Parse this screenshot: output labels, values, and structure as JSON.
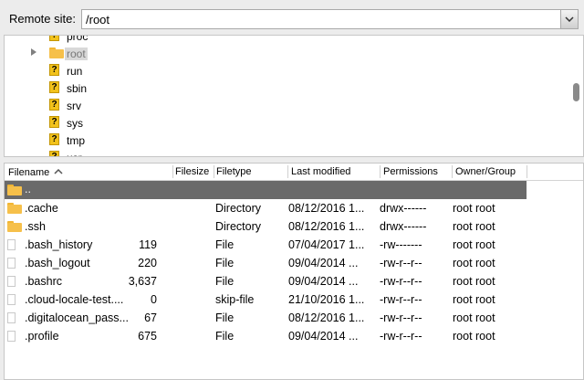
{
  "remote_site": {
    "label": "Remote site:",
    "path": "/root"
  },
  "tree": {
    "items": [
      {
        "label": "proc",
        "icon": "unknown-folder-icon",
        "selected": false
      },
      {
        "label": "root",
        "icon": "folder-icon",
        "selected": true
      },
      {
        "label": "run",
        "icon": "unknown-folder-icon",
        "selected": false
      },
      {
        "label": "sbin",
        "icon": "unknown-folder-icon",
        "selected": false
      },
      {
        "label": "srv",
        "icon": "unknown-folder-icon",
        "selected": false
      },
      {
        "label": "sys",
        "icon": "unknown-folder-icon",
        "selected": false
      },
      {
        "label": "tmp",
        "icon": "unknown-folder-icon",
        "selected": false
      },
      {
        "label": "usr",
        "icon": "unknown-folder-icon",
        "selected": false
      }
    ]
  },
  "list": {
    "columns": {
      "filename": "Filename",
      "filesize": "Filesize",
      "filetype": "Filetype",
      "last_modified": "Last modified",
      "permissions": "Permissions",
      "owner_group": "Owner/Group"
    },
    "parent_label": "..",
    "rows": [
      {
        "name": ".cache",
        "size": "",
        "type": "Directory",
        "modified": "08/12/2016 1...",
        "perms": "drwx------",
        "owner": "root root",
        "icon": "folder-icon"
      },
      {
        "name": ".ssh",
        "size": "",
        "type": "Directory",
        "modified": "08/12/2016 1...",
        "perms": "drwx------",
        "owner": "root root",
        "icon": "folder-icon"
      },
      {
        "name": ".bash_history",
        "size": "119",
        "type": "File",
        "modified": "07/04/2017 1...",
        "perms": "-rw-------",
        "owner": "root root",
        "icon": "file-icon"
      },
      {
        "name": ".bash_logout",
        "size": "220",
        "type": "File",
        "modified": "09/04/2014 ...",
        "perms": "-rw-r--r--",
        "owner": "root root",
        "icon": "file-icon"
      },
      {
        "name": ".bashrc",
        "size": "3,637",
        "type": "File",
        "modified": "09/04/2014 ...",
        "perms": "-rw-r--r--",
        "owner": "root root",
        "icon": "file-icon"
      },
      {
        "name": ".cloud-locale-test....",
        "size": "0",
        "type": "skip-file",
        "modified": "21/10/2016 1...",
        "perms": "-rw-r--r--",
        "owner": "root root",
        "icon": "file-icon"
      },
      {
        "name": ".digitalocean_pass...",
        "size": "67",
        "type": "File",
        "modified": "08/12/2016 1...",
        "perms": "-rw-r--r--",
        "owner": "root root",
        "icon": "file-icon"
      },
      {
        "name": ".profile",
        "size": "675",
        "type": "File",
        "modified": "09/04/2014 ...",
        "perms": "-rw-r--r--",
        "owner": "root root",
        "icon": "file-icon"
      }
    ]
  },
  "colors": {
    "selected_row": "#6a6a6a",
    "folder": "#f6c04a",
    "unknown_folder": "#f2c21b"
  }
}
